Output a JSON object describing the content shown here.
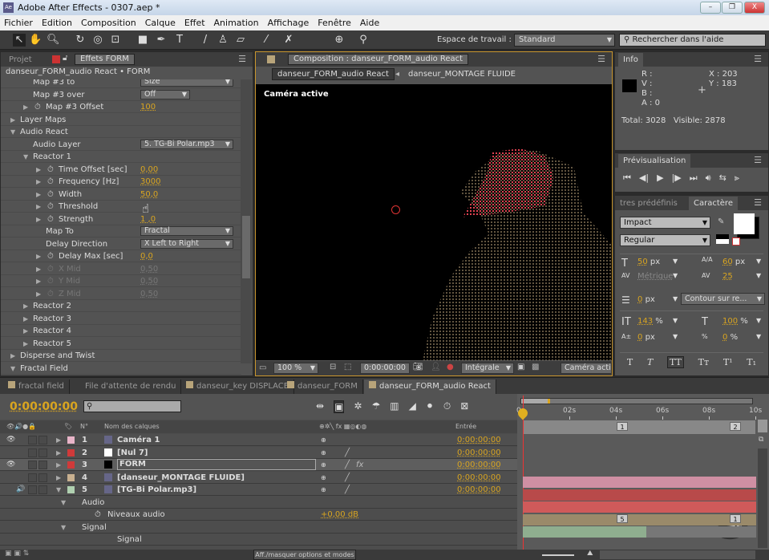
{
  "window": {
    "title": "Adobe After Effects - 0307.aep *",
    "app_icon": "Ae"
  },
  "menu": [
    "Fichier",
    "Edition",
    "Composition",
    "Calque",
    "Effet",
    "Animation",
    "Affichage",
    "Fenêtre",
    "Aide"
  ],
  "toolbar": {
    "workspace_label": "Espace de travail :",
    "workspace_value": "Standard",
    "search_placeholder": "Rechercher dans l'aide"
  },
  "effects_panel": {
    "tab_project": "Projet",
    "tab_effects": "Effets FORM",
    "subtitle": "danseur_FORM_audio React • FORM",
    "rows": [
      {
        "label": "Map #3 to",
        "indent": 1,
        "arrow": "",
        "sw": false,
        "kind": "select",
        "value": "Size"
      },
      {
        "label": "Map #3 over",
        "indent": 1,
        "arrow": "",
        "sw": false,
        "kind": "select-short",
        "value": "Off"
      },
      {
        "label": "Map #3 Offset",
        "indent": 1,
        "arrow": "right",
        "sw": true,
        "kind": "num",
        "value": "100"
      },
      {
        "label": "Layer Maps",
        "indent": 0,
        "arrow": "right",
        "sw": false,
        "kind": "",
        "value": ""
      },
      {
        "label": "Audio React",
        "indent": 0,
        "arrow": "down",
        "sw": false,
        "kind": "",
        "value": ""
      },
      {
        "label": "Audio Layer",
        "indent": 1,
        "arrow": "",
        "sw": false,
        "kind": "select",
        "value": "5. TG-Bi Polar.mp3"
      },
      {
        "label": "Reactor 1",
        "indent": 1,
        "arrow": "down",
        "sw": false,
        "kind": "",
        "value": ""
      },
      {
        "label": "Time Offset [sec]",
        "indent": 2,
        "arrow": "right",
        "sw": true,
        "kind": "num",
        "value": "0,00"
      },
      {
        "label": "Frequency [Hz]",
        "indent": 2,
        "arrow": "right",
        "sw": true,
        "kind": "num",
        "value": "3000"
      },
      {
        "label": "Width",
        "indent": 2,
        "arrow": "right",
        "sw": true,
        "kind": "num",
        "value": "50,0"
      },
      {
        "label": "Threshold",
        "indent": 2,
        "arrow": "right",
        "sw": true,
        "kind": "num",
        "value": ""
      },
      {
        "label": "Strength",
        "indent": 2,
        "arrow": "right",
        "sw": true,
        "kind": "num",
        "value": "1  ,0"
      },
      {
        "label": "Map To",
        "indent": 2,
        "arrow": "",
        "sw": false,
        "kind": "select",
        "value": "Fractal"
      },
      {
        "label": "Delay Direction",
        "indent": 2,
        "arrow": "",
        "sw": false,
        "kind": "select",
        "value": "X Left to Right"
      },
      {
        "label": "Delay Max [sec]",
        "indent": 2,
        "arrow": "right",
        "sw": true,
        "kind": "num",
        "value": "0,0"
      },
      {
        "label": "X Mid",
        "indent": 2,
        "arrow": "right",
        "sw": true,
        "kind": "num",
        "value": "0,50",
        "disabled": true
      },
      {
        "label": "Y Mid",
        "indent": 2,
        "arrow": "right",
        "sw": true,
        "kind": "num",
        "value": "0,50",
        "disabled": true
      },
      {
        "label": "Z Mid",
        "indent": 2,
        "arrow": "right",
        "sw": true,
        "kind": "num",
        "value": "0,50",
        "disabled": true
      },
      {
        "label": "Reactor 2",
        "indent": 1,
        "arrow": "right",
        "sw": false,
        "kind": "",
        "value": ""
      },
      {
        "label": "Reactor 3",
        "indent": 1,
        "arrow": "right",
        "sw": false,
        "kind": "",
        "value": ""
      },
      {
        "label": "Reactor 4",
        "indent": 1,
        "arrow": "right",
        "sw": false,
        "kind": "",
        "value": ""
      },
      {
        "label": "Reactor 5",
        "indent": 1,
        "arrow": "right",
        "sw": false,
        "kind": "",
        "value": ""
      },
      {
        "label": "Disperse and Twist",
        "indent": 0,
        "arrow": "right",
        "sw": false,
        "kind": "",
        "value": ""
      },
      {
        "label": "Fractal Field",
        "indent": 0,
        "arrow": "down",
        "sw": false,
        "kind": "",
        "value": ""
      }
    ]
  },
  "composition": {
    "tab": "Composition : danseur_FORM_audio React",
    "breadcrumb": [
      "danseur_FORM_audio React",
      "danseur_MONTAGE FLUIDE"
    ],
    "view_label": "Caméra active",
    "zoom": "100 %",
    "timecode": "0:00:00:00",
    "resolution": "Intégrale",
    "camera": "Caméra active"
  },
  "info": {
    "tab": "Info",
    "r": "R :",
    "v": "V :",
    "b": "B :",
    "a": "A : 0",
    "x": "X : 203",
    "y": "Y : 183",
    "totals": "Total: 3028   Visible: 2878"
  },
  "preview": {
    "tab": "Prévisualisation"
  },
  "character": {
    "tab_presets": "tres prédéfinis",
    "tab": "Caractère",
    "font": "Impact",
    "style": "Regular",
    "size": "50",
    "size_unit": "px",
    "leading": "60",
    "leading_unit": "px",
    "kerning": "Métrique",
    "tracking": "25",
    "stroke": "0",
    "stroke_unit": "px",
    "stroke_mode": "Contour sur re...",
    "vscale": "143",
    "vscale_unit": "%",
    "hscale": "100",
    "hscale_unit": "%",
    "baseline": "0",
    "baseline_unit": "px",
    "tsume": "0",
    "tsume_unit": "%",
    "fill_color": "#ffffff",
    "stroke_color": "#000000"
  },
  "timeline": {
    "tabs": [
      {
        "label": "fractal field",
        "color": "#b8a47a"
      },
      {
        "label": "File d'attente de rendu",
        "color": ""
      },
      {
        "label": "danseur_key DISPLACE",
        "color": "#b8a47a"
      },
      {
        "label": "danseur_FORM",
        "color": "#b8a47a"
      },
      {
        "label": "danseur_FORM_audio React",
        "color": "#b8a47a"
      }
    ],
    "timecode": "0:00:00:00",
    "col_num": "N°",
    "col_name": "Nom des calques",
    "col_in": "Entrée",
    "layers": [
      {
        "num": "1",
        "name": "Caméra 1",
        "label_color": "#e8b4c8",
        "in": "0:00:00:00",
        "bar": "#cf8fa3",
        "eye": true
      },
      {
        "num": "2",
        "name": "[Nul 7]",
        "label_color": "#d03a3a",
        "in": "0:00:00:00",
        "bar": "#b84a4a",
        "eye": false
      },
      {
        "num": "3",
        "name": "FORM",
        "label_color": "#d03a3a",
        "in": "0:00:00:00",
        "bar": "#d05a5a",
        "eye": true,
        "fx": "fx"
      },
      {
        "num": "4",
        "name": "[danseur_MONTAGE FLUIDE]",
        "label_color": "#c8b090",
        "in": "0:00:00:00",
        "bar": "#9a8a6a",
        "eye": false
      },
      {
        "num": "5",
        "name": "[TG-Bi Polar.mp3]",
        "label_color": "#b0d0b0",
        "in": "0:00:00:00",
        "bar": "#8fae8f",
        "eye": false
      }
    ],
    "sub_rows": [
      {
        "label": "Audio",
        "value": ""
      },
      {
        "label": "Niveaux audio",
        "value": "+0,00 dB"
      },
      {
        "label": "Signal",
        "value": ""
      },
      {
        "label": "Signal",
        "value": ""
      }
    ],
    "ruler": [
      "0s",
      "02s",
      "04s",
      "06s",
      "08s",
      "10s"
    ],
    "comp_markers": [
      "1",
      "2"
    ],
    "layer4_markers": [
      "5",
      "1"
    ],
    "audio_bar_fraction": 0.53,
    "toggle_button": "Aff./masquer options et modes",
    "watermark": "VTC"
  }
}
